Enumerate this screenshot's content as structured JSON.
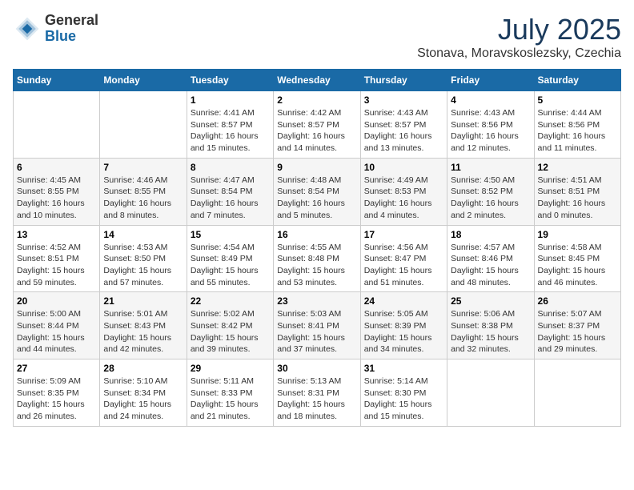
{
  "header": {
    "logo_general": "General",
    "logo_blue": "Blue",
    "month_title": "July 2025",
    "location": "Stonava, Moravskoslezsky, Czechia"
  },
  "weekdays": [
    "Sunday",
    "Monday",
    "Tuesday",
    "Wednesday",
    "Thursday",
    "Friday",
    "Saturday"
  ],
  "weeks": [
    [
      {
        "day": "",
        "info": ""
      },
      {
        "day": "",
        "info": ""
      },
      {
        "day": "1",
        "info": "Sunrise: 4:41 AM\nSunset: 8:57 PM\nDaylight: 16 hours and 15 minutes."
      },
      {
        "day": "2",
        "info": "Sunrise: 4:42 AM\nSunset: 8:57 PM\nDaylight: 16 hours and 14 minutes."
      },
      {
        "day": "3",
        "info": "Sunrise: 4:43 AM\nSunset: 8:57 PM\nDaylight: 16 hours and 13 minutes."
      },
      {
        "day": "4",
        "info": "Sunrise: 4:43 AM\nSunset: 8:56 PM\nDaylight: 16 hours and 12 minutes."
      },
      {
        "day": "5",
        "info": "Sunrise: 4:44 AM\nSunset: 8:56 PM\nDaylight: 16 hours and 11 minutes."
      }
    ],
    [
      {
        "day": "6",
        "info": "Sunrise: 4:45 AM\nSunset: 8:55 PM\nDaylight: 16 hours and 10 minutes."
      },
      {
        "day": "7",
        "info": "Sunrise: 4:46 AM\nSunset: 8:55 PM\nDaylight: 16 hours and 8 minutes."
      },
      {
        "day": "8",
        "info": "Sunrise: 4:47 AM\nSunset: 8:54 PM\nDaylight: 16 hours and 7 minutes."
      },
      {
        "day": "9",
        "info": "Sunrise: 4:48 AM\nSunset: 8:54 PM\nDaylight: 16 hours and 5 minutes."
      },
      {
        "day": "10",
        "info": "Sunrise: 4:49 AM\nSunset: 8:53 PM\nDaylight: 16 hours and 4 minutes."
      },
      {
        "day": "11",
        "info": "Sunrise: 4:50 AM\nSunset: 8:52 PM\nDaylight: 16 hours and 2 minutes."
      },
      {
        "day": "12",
        "info": "Sunrise: 4:51 AM\nSunset: 8:51 PM\nDaylight: 16 hours and 0 minutes."
      }
    ],
    [
      {
        "day": "13",
        "info": "Sunrise: 4:52 AM\nSunset: 8:51 PM\nDaylight: 15 hours and 59 minutes."
      },
      {
        "day": "14",
        "info": "Sunrise: 4:53 AM\nSunset: 8:50 PM\nDaylight: 15 hours and 57 minutes."
      },
      {
        "day": "15",
        "info": "Sunrise: 4:54 AM\nSunset: 8:49 PM\nDaylight: 15 hours and 55 minutes."
      },
      {
        "day": "16",
        "info": "Sunrise: 4:55 AM\nSunset: 8:48 PM\nDaylight: 15 hours and 53 minutes."
      },
      {
        "day": "17",
        "info": "Sunrise: 4:56 AM\nSunset: 8:47 PM\nDaylight: 15 hours and 51 minutes."
      },
      {
        "day": "18",
        "info": "Sunrise: 4:57 AM\nSunset: 8:46 PM\nDaylight: 15 hours and 48 minutes."
      },
      {
        "day": "19",
        "info": "Sunrise: 4:58 AM\nSunset: 8:45 PM\nDaylight: 15 hours and 46 minutes."
      }
    ],
    [
      {
        "day": "20",
        "info": "Sunrise: 5:00 AM\nSunset: 8:44 PM\nDaylight: 15 hours and 44 minutes."
      },
      {
        "day": "21",
        "info": "Sunrise: 5:01 AM\nSunset: 8:43 PM\nDaylight: 15 hours and 42 minutes."
      },
      {
        "day": "22",
        "info": "Sunrise: 5:02 AM\nSunset: 8:42 PM\nDaylight: 15 hours and 39 minutes."
      },
      {
        "day": "23",
        "info": "Sunrise: 5:03 AM\nSunset: 8:41 PM\nDaylight: 15 hours and 37 minutes."
      },
      {
        "day": "24",
        "info": "Sunrise: 5:05 AM\nSunset: 8:39 PM\nDaylight: 15 hours and 34 minutes."
      },
      {
        "day": "25",
        "info": "Sunrise: 5:06 AM\nSunset: 8:38 PM\nDaylight: 15 hours and 32 minutes."
      },
      {
        "day": "26",
        "info": "Sunrise: 5:07 AM\nSunset: 8:37 PM\nDaylight: 15 hours and 29 minutes."
      }
    ],
    [
      {
        "day": "27",
        "info": "Sunrise: 5:09 AM\nSunset: 8:35 PM\nDaylight: 15 hours and 26 minutes."
      },
      {
        "day": "28",
        "info": "Sunrise: 5:10 AM\nSunset: 8:34 PM\nDaylight: 15 hours and 24 minutes."
      },
      {
        "day": "29",
        "info": "Sunrise: 5:11 AM\nSunset: 8:33 PM\nDaylight: 15 hours and 21 minutes."
      },
      {
        "day": "30",
        "info": "Sunrise: 5:13 AM\nSunset: 8:31 PM\nDaylight: 15 hours and 18 minutes."
      },
      {
        "day": "31",
        "info": "Sunrise: 5:14 AM\nSunset: 8:30 PM\nDaylight: 15 hours and 15 minutes."
      },
      {
        "day": "",
        "info": ""
      },
      {
        "day": "",
        "info": ""
      }
    ]
  ]
}
